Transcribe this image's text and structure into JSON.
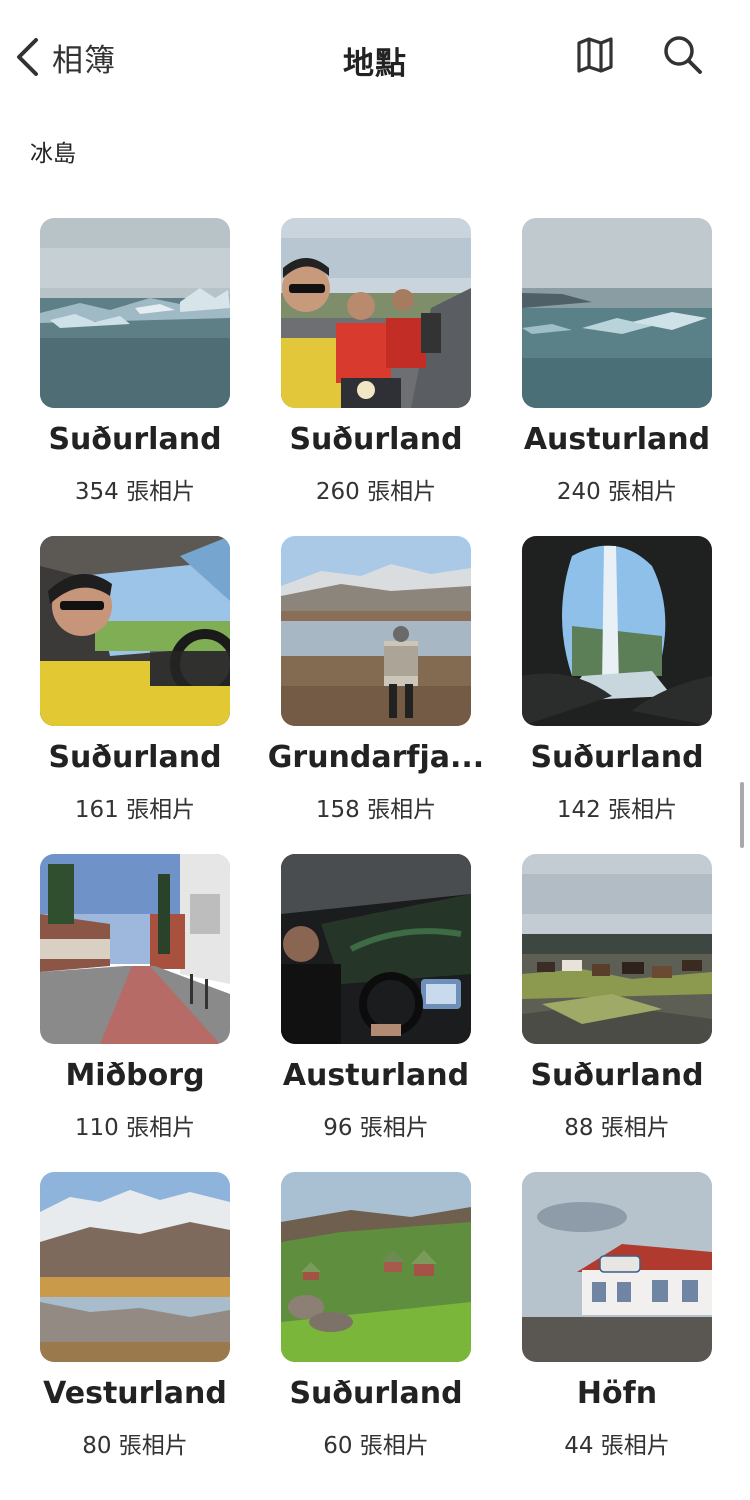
{
  "header": {
    "back_label": "相簿",
    "title": "地點"
  },
  "section": {
    "heading": "冰島"
  },
  "places": [
    {
      "name": "Suðurland",
      "count": "354 張相片"
    },
    {
      "name": "Suðurland",
      "count": "260 張相片"
    },
    {
      "name": "Austurland",
      "count": "240 張相片"
    },
    {
      "name": "Suðurland",
      "count": "161 張相片"
    },
    {
      "name": "Grundarfja...",
      "count": "158 張相片"
    },
    {
      "name": "Suðurland",
      "count": "142 張相片"
    },
    {
      "name": "Miðborg",
      "count": "110 張相片"
    },
    {
      "name": "Austurland",
      "count": "96 張相片"
    },
    {
      "name": "Suðurland",
      "count": "88 張相片"
    },
    {
      "name": "Vesturland",
      "count": "80 張相片"
    },
    {
      "name": "Suðurland",
      "count": "60 張相片"
    },
    {
      "name": "Höfn",
      "count": "44 張相片"
    }
  ],
  "icons": {
    "back": "chevron-left-icon",
    "map": "map-icon",
    "search": "search-icon"
  },
  "colors": {
    "text": "#222222",
    "icon": "#333333",
    "scrollbar": "#a9a9a9"
  }
}
